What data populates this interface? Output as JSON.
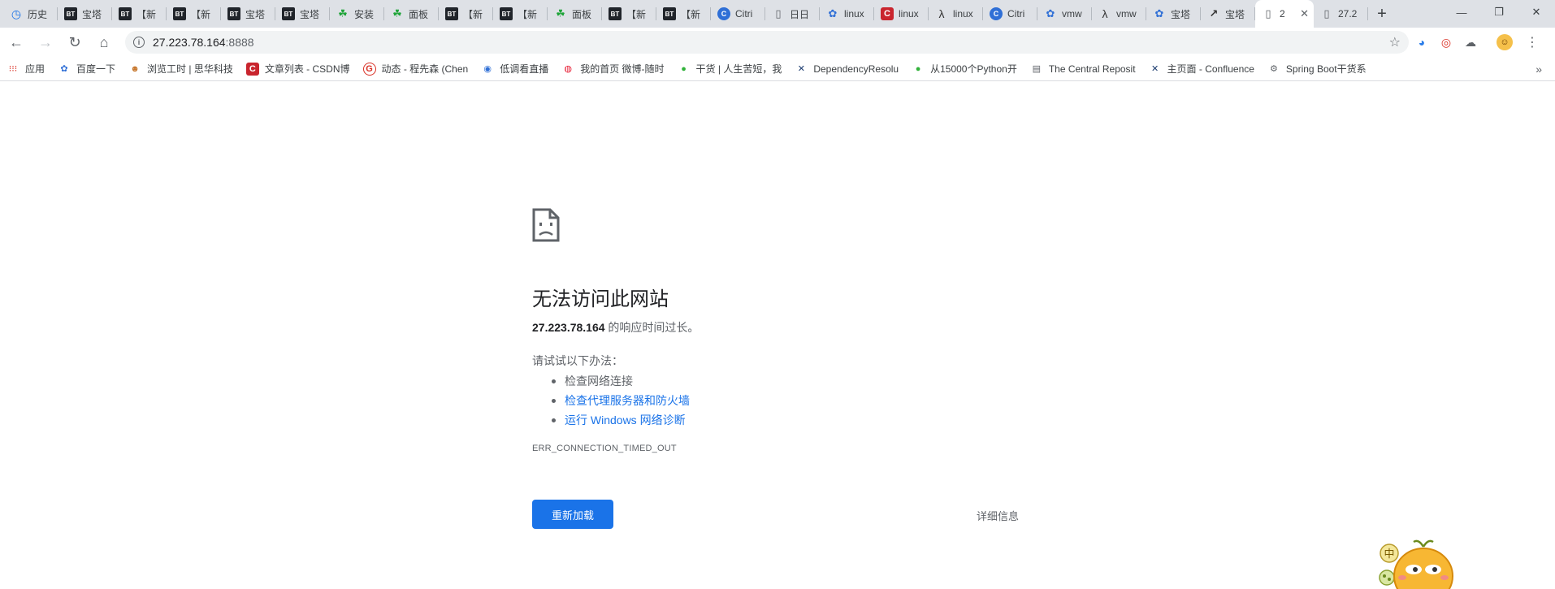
{
  "tabs": [
    {
      "icon": "clock",
      "label": "历史"
    },
    {
      "icon": "bt",
      "label": "宝塔"
    },
    {
      "icon": "bt",
      "label": "【新"
    },
    {
      "icon": "bt",
      "label": "【新"
    },
    {
      "icon": "bt",
      "label": "宝塔"
    },
    {
      "icon": "bt",
      "label": "宝塔"
    },
    {
      "icon": "leaf",
      "label": "安装"
    },
    {
      "icon": "leaf",
      "label": "面板"
    },
    {
      "icon": "bt",
      "label": "【新"
    },
    {
      "icon": "bt",
      "label": "【新"
    },
    {
      "icon": "leaf",
      "label": "面板"
    },
    {
      "icon": "bt",
      "label": "【新"
    },
    {
      "icon": "bt",
      "label": "【新"
    },
    {
      "icon": "citrix",
      "label": "Citri"
    },
    {
      "icon": "doc",
      "label": "日日"
    },
    {
      "icon": "paw",
      "label": "linux"
    },
    {
      "icon": "csdn",
      "label": "linux"
    },
    {
      "icon": "lambda",
      "label": "linux"
    },
    {
      "icon": "citrix",
      "label": "Citri"
    },
    {
      "icon": "paw",
      "label": "vmw"
    },
    {
      "icon": "lambda",
      "label": "vmw"
    },
    {
      "icon": "paw",
      "label": "宝塔"
    },
    {
      "icon": "arrow",
      "label": "宝塔"
    },
    {
      "icon": "doc",
      "label": "2",
      "active": true
    },
    {
      "icon": "doc",
      "label": "27.2"
    }
  ],
  "tab_icon_glyphs": {
    "bt": "BT",
    "clock": "◷",
    "leaf": "☘",
    "citrix": "C",
    "doc": "▯",
    "paw": "✿",
    "csdn": "C",
    "lambda": "λ",
    "arrow": "↗"
  },
  "tab_close_glyph": "✕",
  "new_tab_glyph": "+",
  "window": {
    "minimize": "—",
    "maximize": "❐",
    "close": "✕"
  },
  "toolbar": {
    "back": "←",
    "forward": "→",
    "reload": "↻",
    "home": "⌂",
    "url_host": "27.223.78.164",
    "url_port": ":8888",
    "info_glyph": "i",
    "star": "☆",
    "menu": "⋮",
    "avatar_glyph": "☺"
  },
  "bookmarks": [
    {
      "icon": "apps",
      "glyph": "⁝⁝⁝",
      "label": "应用"
    },
    {
      "icon": "baidu",
      "glyph": "✿",
      "label": "百度一下"
    },
    {
      "icon": "elephant",
      "glyph": "☻",
      "label": "浏览工时 | 思华科技"
    },
    {
      "icon": "csdn",
      "glyph": "C",
      "label": "文章列表 - CSDN博"
    },
    {
      "icon": "g",
      "glyph": "G",
      "label": "动态 - 程先森 (Chen"
    },
    {
      "icon": "live",
      "glyph": "◉",
      "label": "低调看直播"
    },
    {
      "icon": "weibo",
      "glyph": "◍",
      "label": "我的首页 微博-随时"
    },
    {
      "icon": "wechat",
      "glyph": "●",
      "label": "干货 | 人生苦短，我"
    },
    {
      "icon": "x",
      "glyph": "✕",
      "label": "DependencyResolu"
    },
    {
      "icon": "wechat",
      "glyph": "●",
      "label": "从15000个Python开"
    },
    {
      "icon": "book",
      "glyph": "▤",
      "label": "The Central Reposit"
    },
    {
      "icon": "x",
      "glyph": "✕",
      "label": "主页面 - Confluence"
    },
    {
      "icon": "spring",
      "glyph": "⚙",
      "label": "Spring Boot干货系"
    }
  ],
  "bookmarks_more": "»",
  "error": {
    "title": "无法访问此网站",
    "host": "27.223.78.164",
    "desc_suffix": " 的响应时间过长。",
    "try_label": "请试试以下办法：",
    "suggestions": [
      {
        "text": "检查网络连接",
        "link": false
      },
      {
        "text": "检查代理服务器和防火墙",
        "link": true
      },
      {
        "text": "运行 Windows 网络诊断",
        "link": true
      }
    ],
    "code": "ERR_CONNECTION_TIMED_OUT",
    "reload_label": "重新加载",
    "details_label": "详细信息"
  },
  "colors": {
    "accent": "#1a73e8",
    "tabstrip": "#dee1e6",
    "text_secondary": "#5f6368"
  }
}
